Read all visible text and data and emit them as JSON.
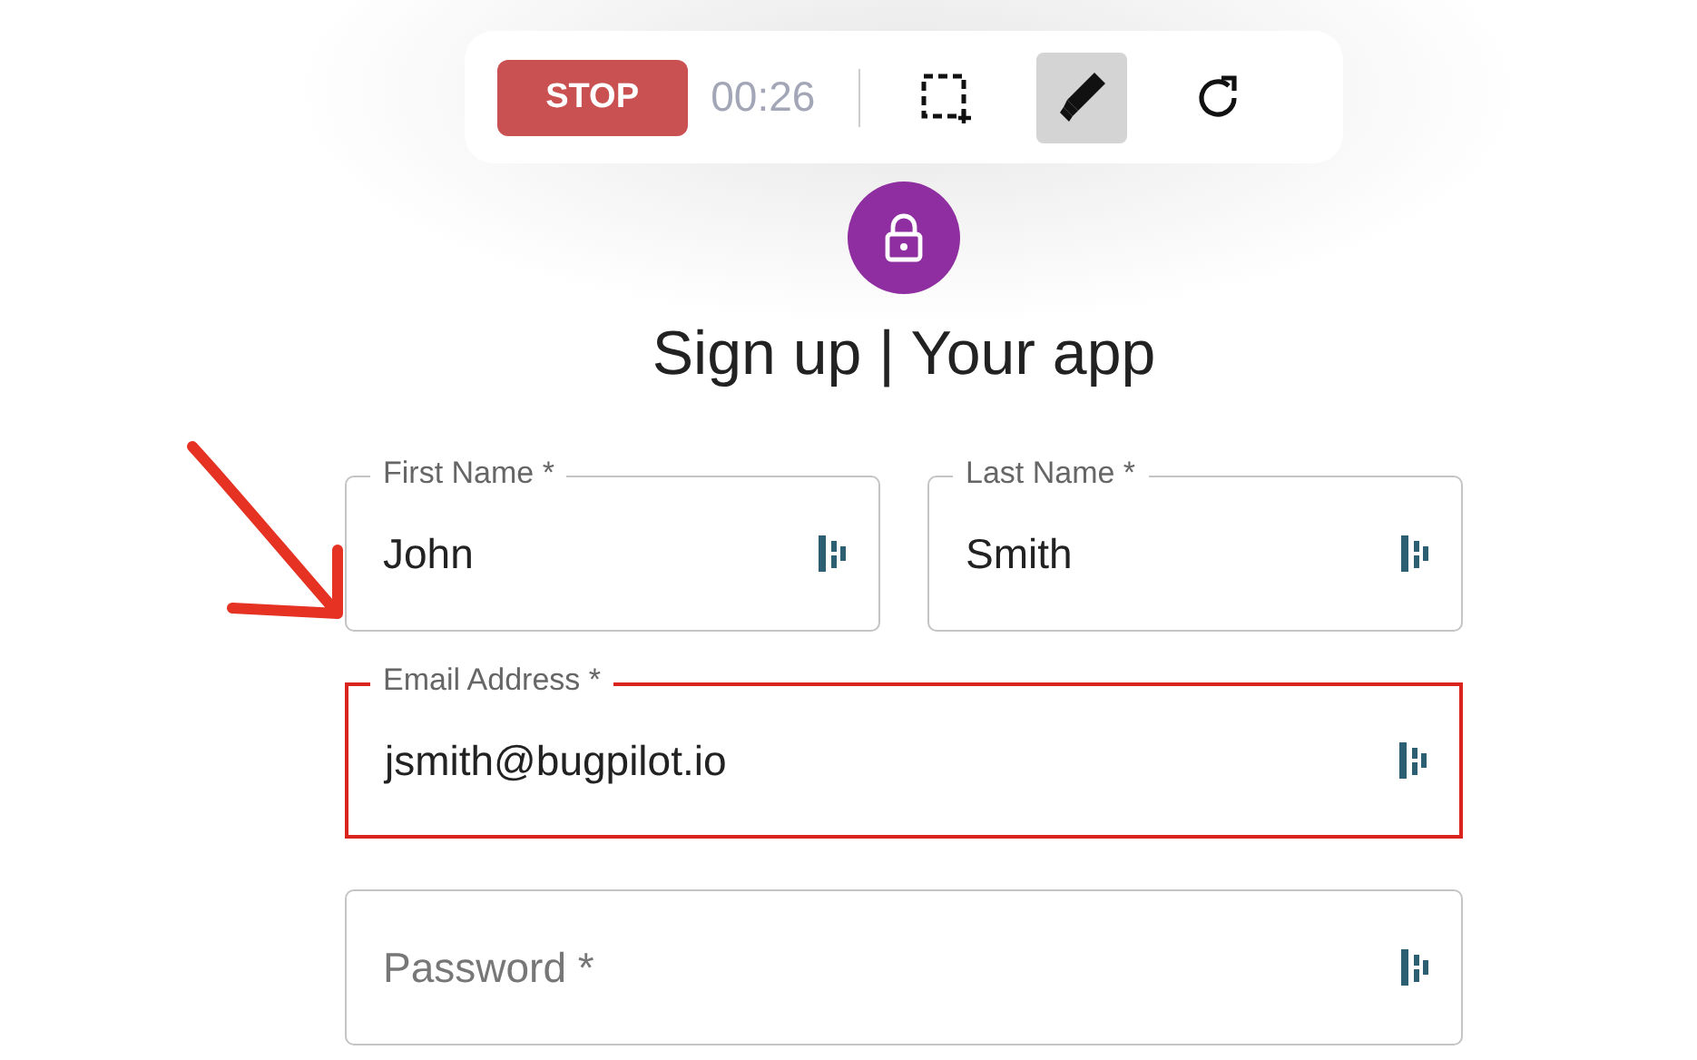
{
  "toolbar": {
    "stop_button": "STOP",
    "timer": "00:26",
    "tools": [
      {
        "kind": "crop",
        "selected": false
      },
      {
        "kind": "pen",
        "selected": true
      },
      {
        "kind": "refresh",
        "selected": false
      }
    ]
  },
  "title": "Sign up | Your app",
  "rows": [
    [
      {
        "label": "First Name *",
        "value": "John",
        "highlighted": false
      },
      {
        "label": "Last Name *",
        "value": "Smith",
        "highlighted": false
      }
    ],
    [
      {
        "label": "Email Address *",
        "value": "jsmith@bugpilot.io",
        "highlighted": true
      }
    ],
    [
      {
        "placeholder": "Password *",
        "highlighted": false
      }
    ]
  ],
  "annotation_arrow": true
}
